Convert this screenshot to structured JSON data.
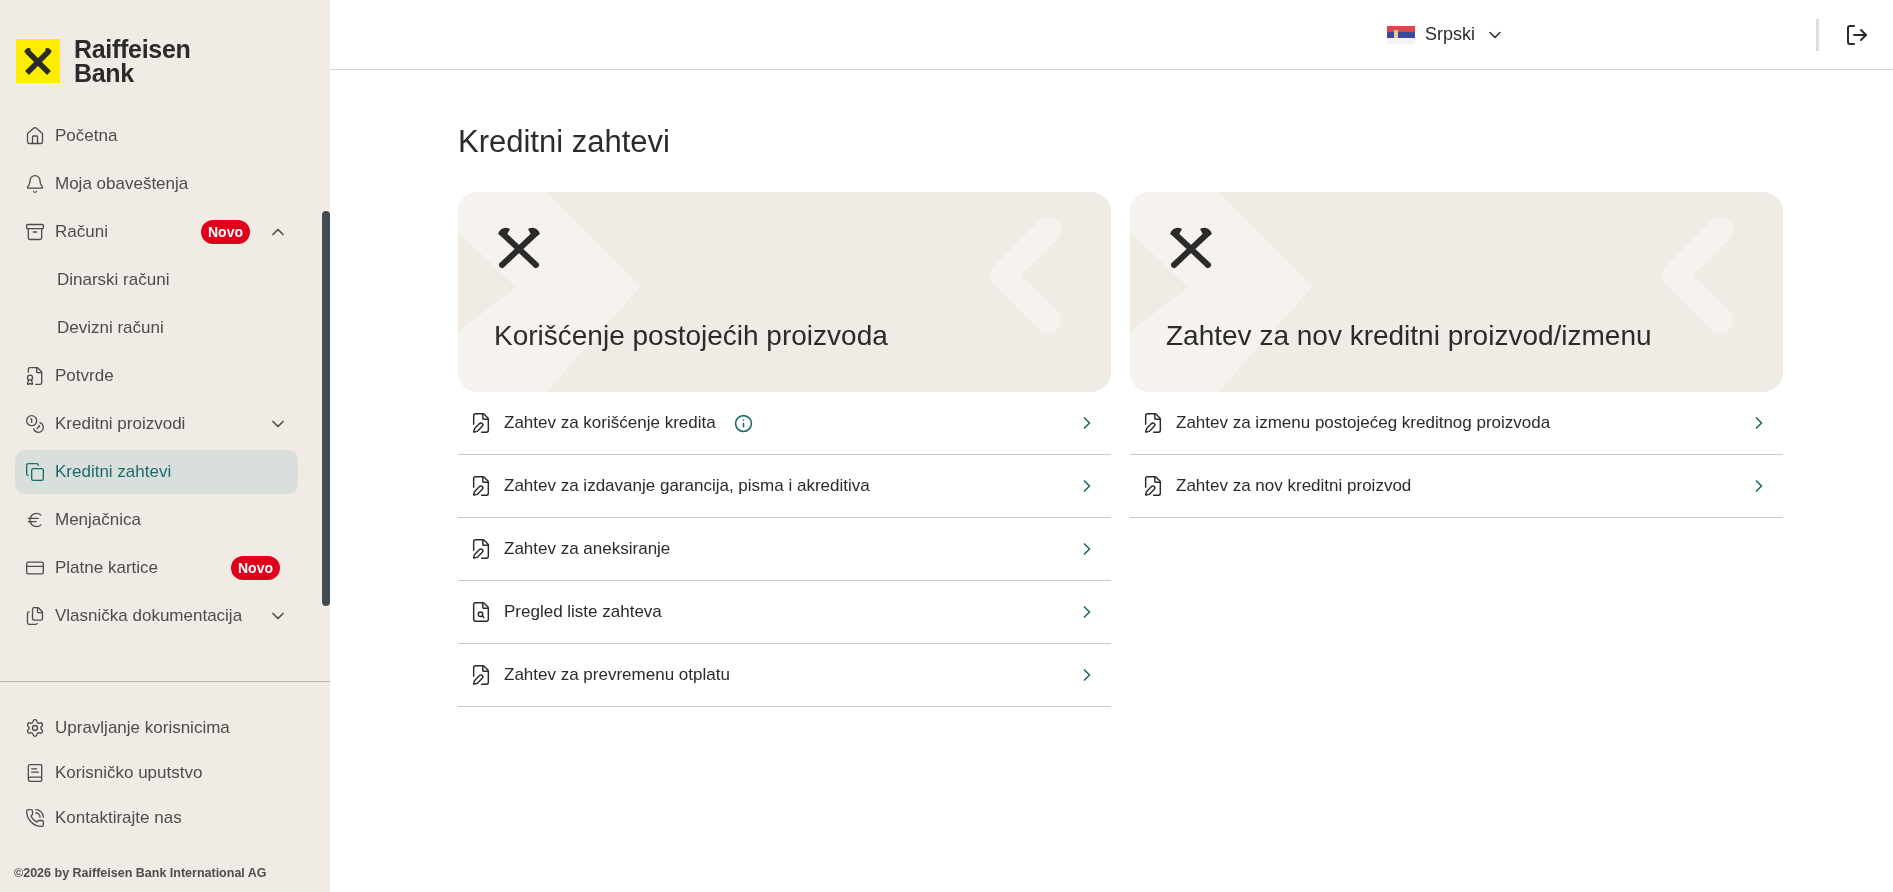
{
  "brand": {
    "line_1": "Raiffeisen",
    "line_2": "Bank"
  },
  "sidebar": {
    "items": [
      {
        "kind": "link",
        "label": "Početna",
        "selected": false
      },
      {
        "kind": "link",
        "label": "Moja obaveštenja",
        "selected": false
      },
      {
        "kind": "group",
        "label": "Računi",
        "badge": "Novo",
        "expanded": true,
        "selected": false
      },
      {
        "kind": "sub",
        "label": "Dinarski računi",
        "selected": false
      },
      {
        "kind": "sub",
        "label": "Devizni računi",
        "selected": false
      },
      {
        "kind": "link",
        "label": "Potvrde",
        "selected": false
      },
      {
        "kind": "group",
        "label": "Kreditni proizvodi",
        "expanded": false,
        "selected": false
      },
      {
        "kind": "link",
        "label": "Kreditni zahtevi",
        "selected": true
      },
      {
        "kind": "link",
        "label": "Menjačnica",
        "selected": false
      },
      {
        "kind": "link",
        "label": "Platne kartice",
        "badge": "Novo",
        "selected": false
      },
      {
        "kind": "group",
        "label": "Vlasnička dokumentacija",
        "expanded": false,
        "selected": false
      }
    ],
    "footer_items": [
      {
        "label": "Upravljanje korisnicima"
      },
      {
        "label": "Korisničko uputstvo"
      },
      {
        "label": "Kontaktirajte nas"
      }
    ],
    "copyright": "©2026 by Raiffeisen Bank International AG"
  },
  "header": {
    "language": "Srpski"
  },
  "page": {
    "title": "Kreditni zahtevi",
    "sections": [
      {
        "title": "Korišćenje postojećih proizvoda",
        "items": [
          {
            "kind": "request",
            "label": "Zahtev za korišćenje kredita",
            "info": true
          },
          {
            "kind": "request",
            "label": "Zahtev za izdavanje garancija, pisma i akreditiva",
            "info": false
          },
          {
            "kind": "request",
            "label": "Zahtev za aneksiranje",
            "info": false
          },
          {
            "kind": "search",
            "label": "Pregled liste zahteva",
            "info": false
          },
          {
            "kind": "request",
            "label": "Zahtev za prevremenu otplatu",
            "info": false
          }
        ]
      },
      {
        "title": "Zahtev za nov kreditni proizvod/izmenu",
        "items": [
          {
            "kind": "request",
            "label": "Zahtev za izmenu postojećeg kreditnog proizvoda",
            "info": false
          },
          {
            "kind": "request",
            "label": "Zahtev za nov kreditni proizvod",
            "info": false
          }
        ]
      }
    ]
  }
}
